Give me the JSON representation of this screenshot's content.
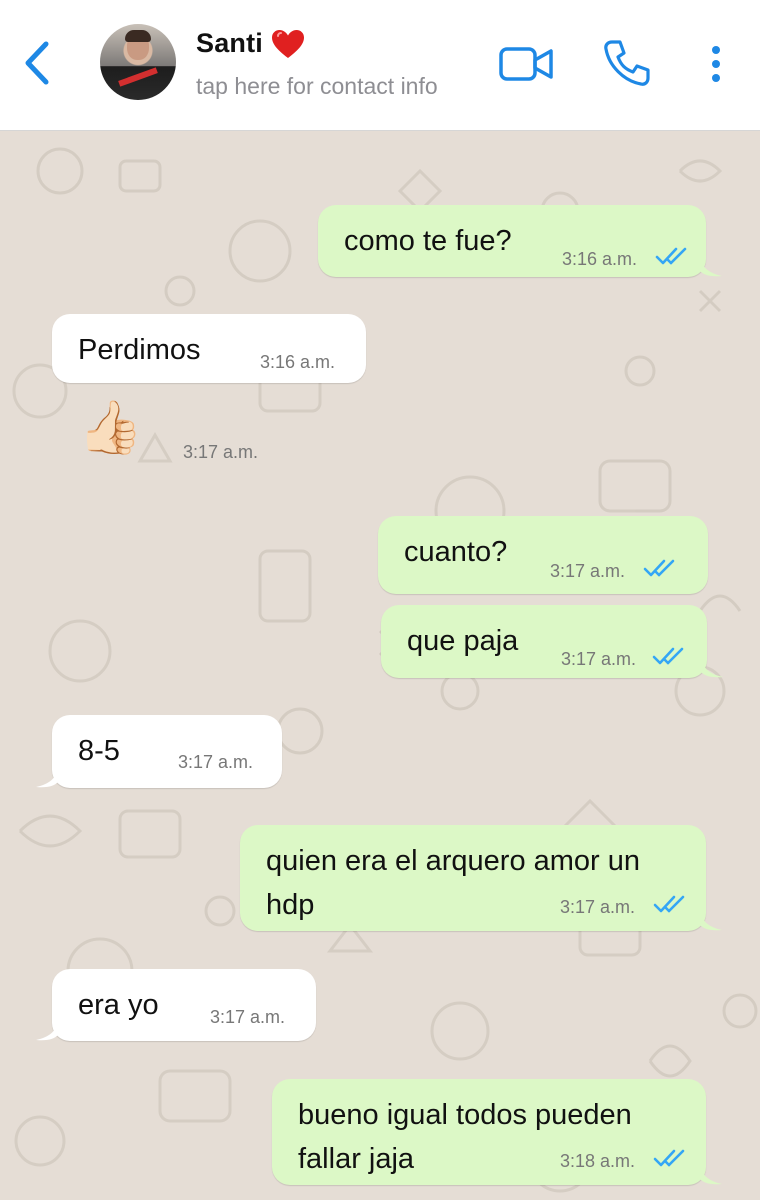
{
  "header": {
    "contact_name": "Santi",
    "subtitle": "tap here for contact info",
    "accent_color": "#1e88e5"
  },
  "messages": [
    {
      "dir": "out",
      "text": "como te fue?",
      "time": "3:16 a.m.",
      "read": true
    },
    {
      "dir": "in",
      "text": "Perdimos",
      "time": "3:16 a.m."
    },
    {
      "dir": "in",
      "emoji": "👍🏻",
      "time": "3:17 a.m."
    },
    {
      "dir": "out",
      "text": "cuanto?",
      "time": "3:17 a.m.",
      "read": true
    },
    {
      "dir": "out",
      "text": "que paja",
      "time": "3:17 a.m.",
      "read": true
    },
    {
      "dir": "in",
      "text": "8-5",
      "time": "3:17 a.m."
    },
    {
      "dir": "out",
      "text": "quien era el arquero amor un\nhdp",
      "time": "3:17 a.m.",
      "read": true
    },
    {
      "dir": "in",
      "text": "era yo",
      "time": "3:17 a.m."
    },
    {
      "dir": "out",
      "text": "bueno igual todos pueden\nfallar jaja",
      "time": "3:18 a.m.",
      "read": true
    }
  ]
}
